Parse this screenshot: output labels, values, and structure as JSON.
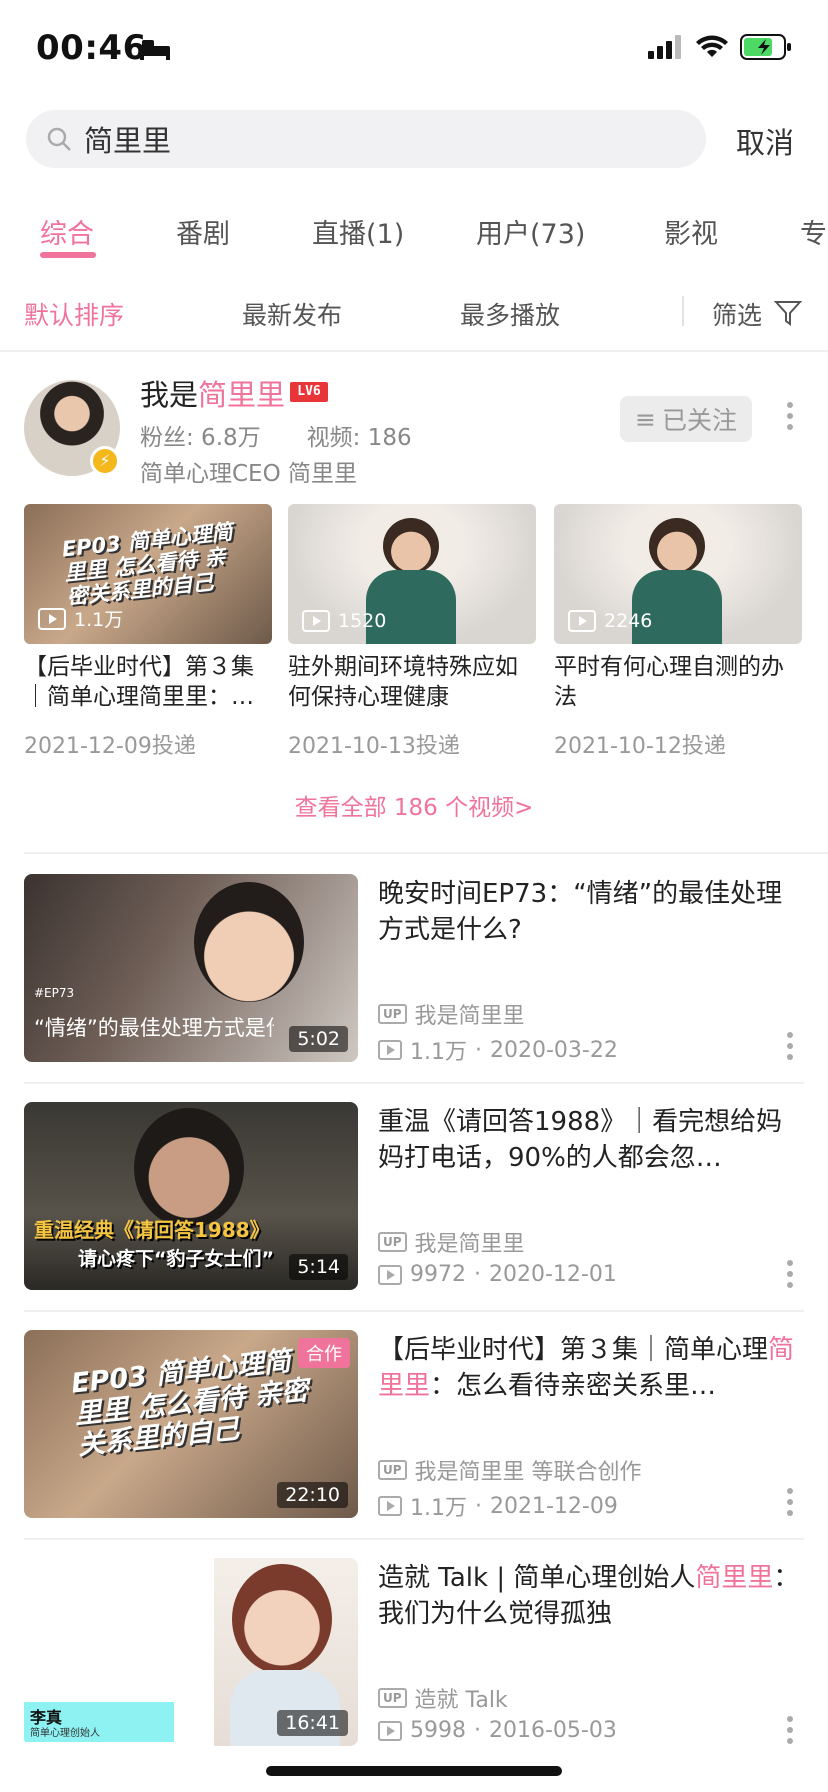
{
  "status": {
    "time": "00:46"
  },
  "search": {
    "query": "简里里",
    "cancel": "取消"
  },
  "tabs": [
    "综合",
    "番剧",
    "直播(1)",
    "用户(73)",
    "影视",
    "专"
  ],
  "sort": {
    "default": "默认排序",
    "newest": "最新发布",
    "most_played": "最多播放",
    "filter": "筛选"
  },
  "user": {
    "name_prefix": "我是",
    "name_highlight": "简里里",
    "level": "LV6",
    "stats": "粉丝: 6.8万　　视频: 186",
    "desc": "简单心理CEO 简里里",
    "follow": "已关注"
  },
  "mini_videos": [
    {
      "title": "【后毕业时代】第３集｜简单心理简里里：…",
      "plays": "1.1万",
      "date": "2021-12-09投递",
      "thumb_text": "EP03 简单心理简里里 怎么看待 亲密关系里的自己"
    },
    {
      "title": "驻外期间环境特殊应如何保持心理健康",
      "plays": "1520",
      "date": "2021-10-13投递"
    },
    {
      "title": "平时有何心理自测的办法",
      "plays": "2246",
      "date": "2021-10-12投递"
    }
  ],
  "view_all": "查看全部 186 个视频>",
  "results": [
    {
      "title": "晚安时间EP73：“情绪”的最佳处理方式是什么?",
      "up": "我是简里里",
      "plays": "1.1万",
      "date": "2020-03-22",
      "duration": "5:02",
      "thumb_tag": "#EP73",
      "thumb_caption": "“情绪”的最佳处理方式是什么"
    },
    {
      "title": "重温《请回答1988》｜看完想给妈妈打电话，90%的人都会忽…",
      "up": "我是简里里",
      "plays": "9972",
      "date": "2020-12-01",
      "duration": "5:14",
      "thumb_line1": "重温经典《请回答1988》",
      "thumb_line2": "请心疼下“豹子女士们”"
    },
    {
      "title_a": "【后毕业时代】第３集｜简单心理",
      "title_hl": "简里里",
      "title_b": "：怎么看待亲密关系里…",
      "up": "我是简里里 等联合创作",
      "plays": "1.1万",
      "date": "2021-12-09",
      "duration": "22:10",
      "badge": "合作",
      "thumb_text": "EP03 简单心理简里里 怎么看待 亲密关系里的自己"
    },
    {
      "title_a": "造就 Talk | 简单心理创始人",
      "title_hl": "简里里",
      "title_b": "：我们为什么觉得孤独",
      "up": "造就 Talk",
      "plays": "5998",
      "date": "2016-05-03",
      "duration": "16:41",
      "thumb_name": "李真",
      "thumb_sub": "简单心理创始人"
    }
  ],
  "colors": {
    "accent": "#f0739b",
    "level_badge": "#e8353a",
    "battery": "#4cd964"
  }
}
